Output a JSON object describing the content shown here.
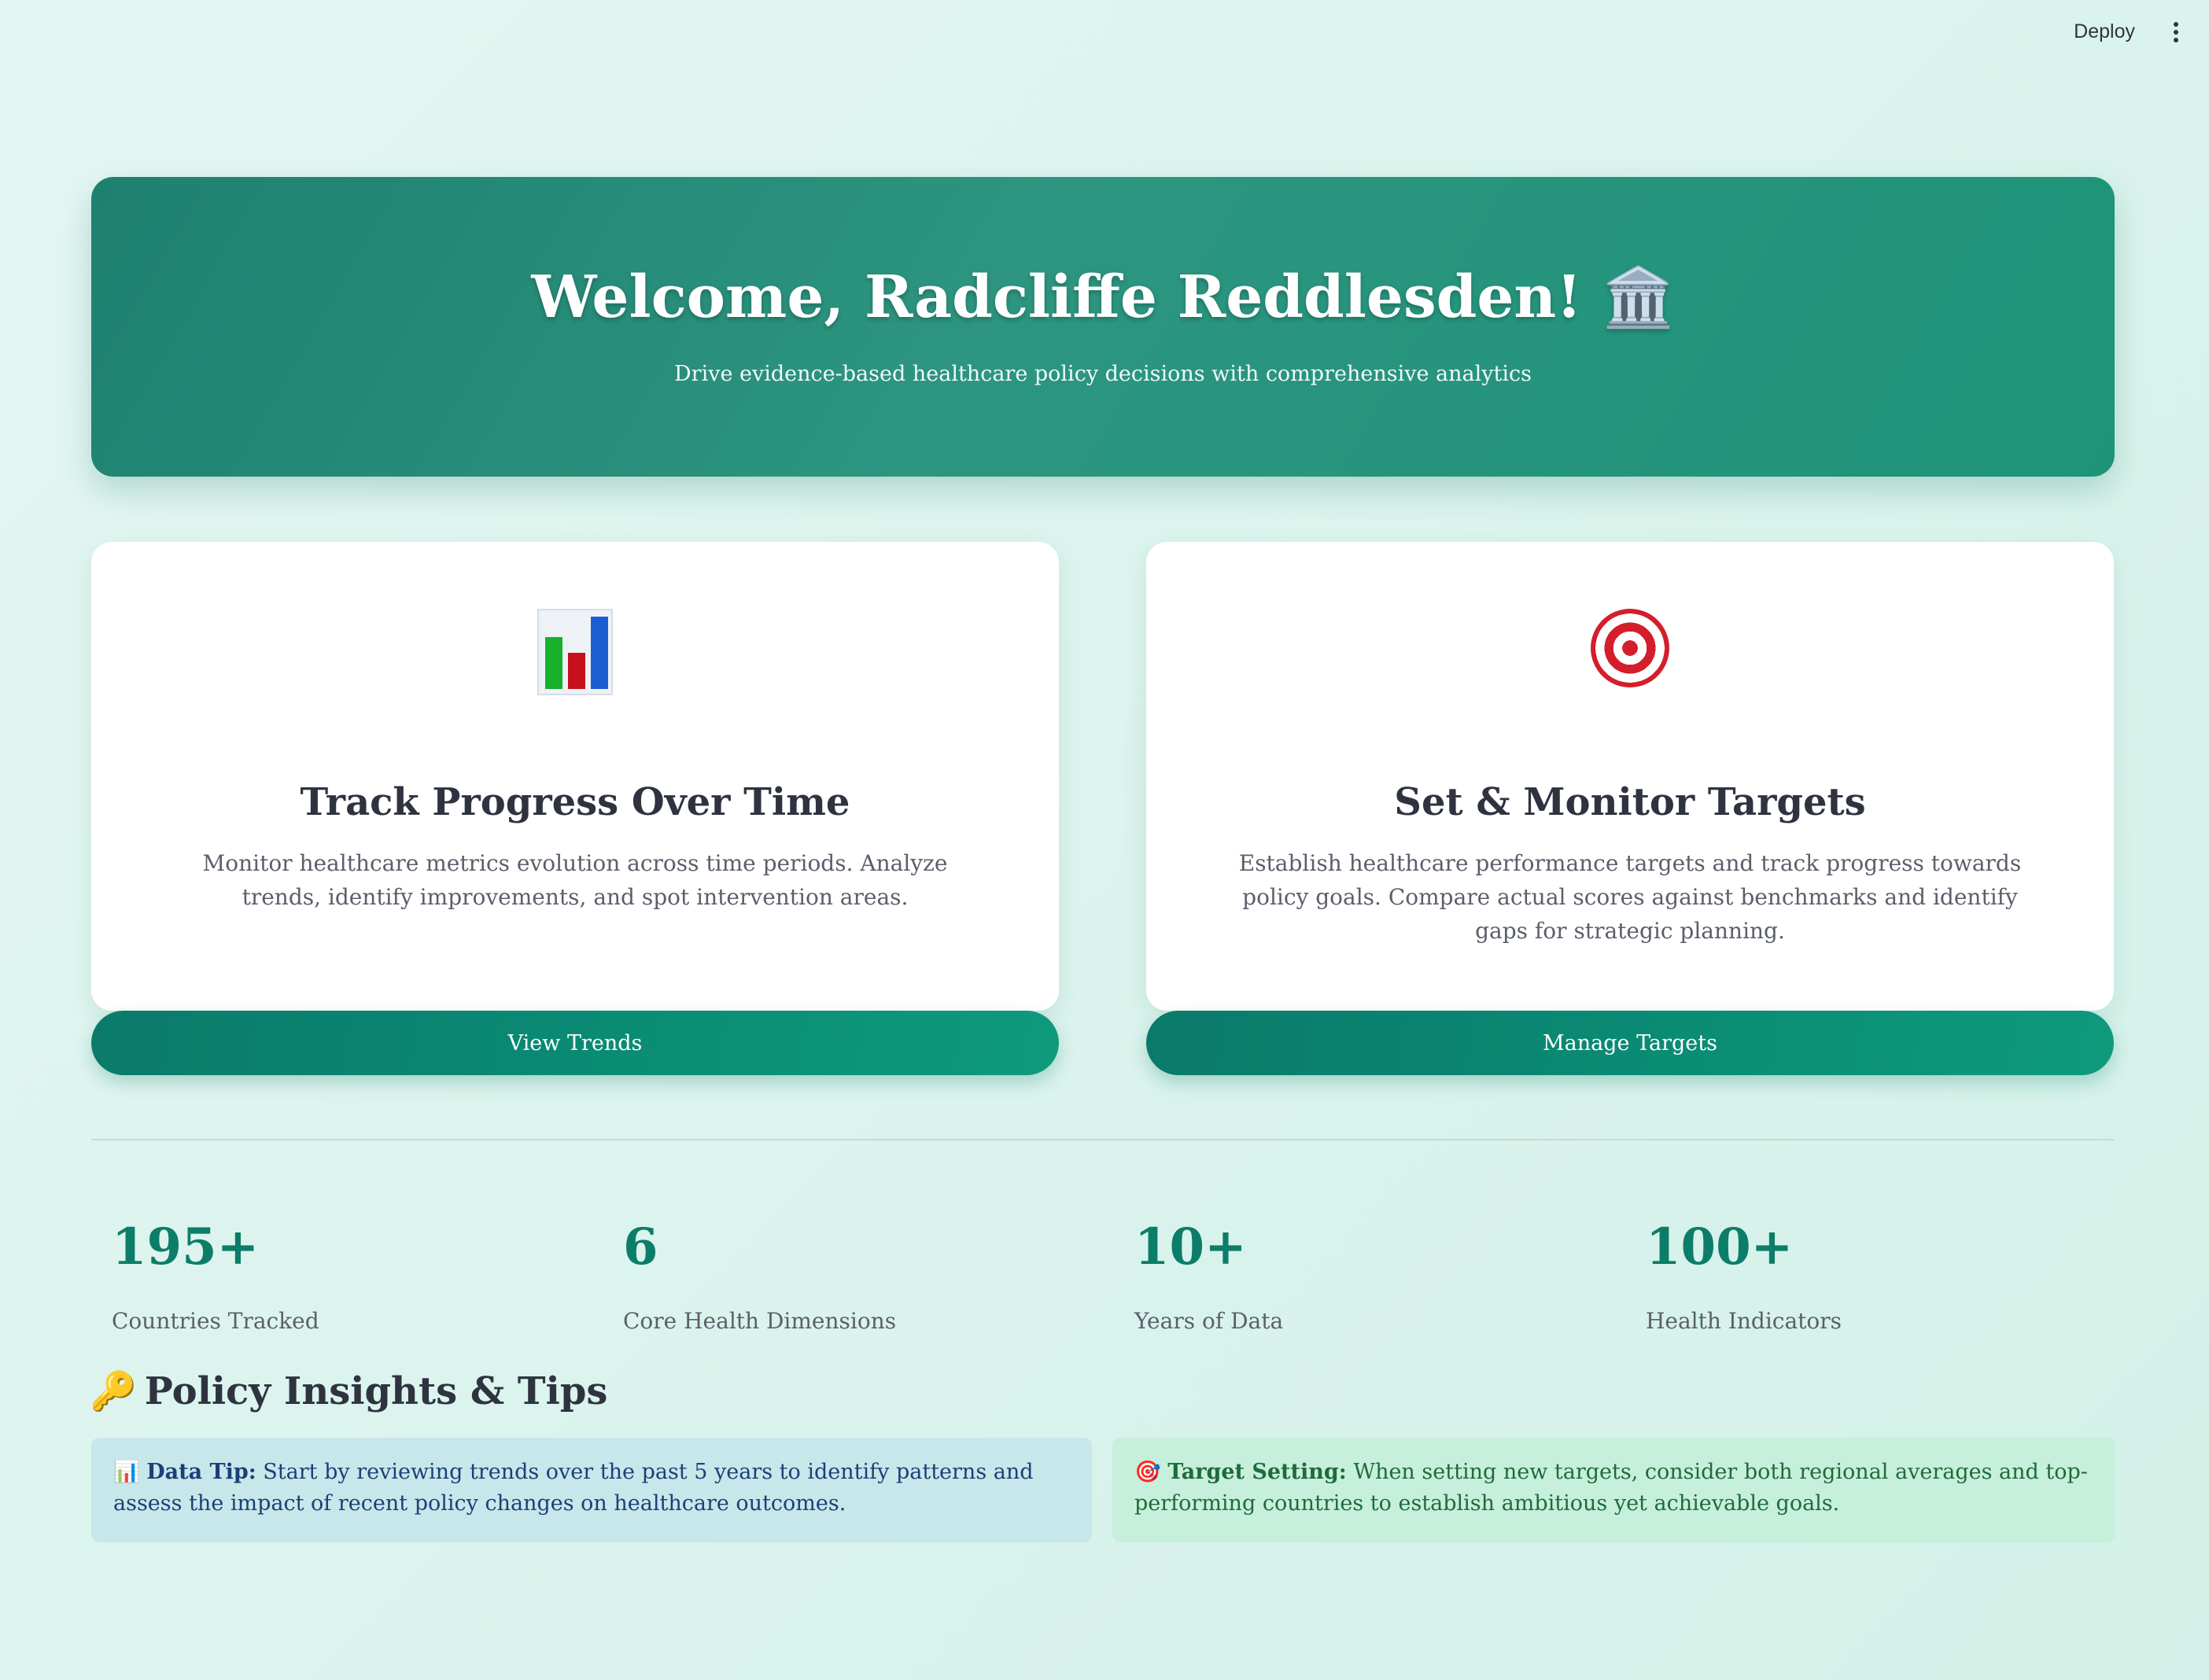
{
  "topbar": {
    "deploy_label": "Deploy"
  },
  "hero": {
    "title": "Welcome, Radcliffe Reddlesden! 🏛️",
    "subtitle": "Drive evidence-based healthcare policy decisions with comprehensive analytics"
  },
  "cards": [
    {
      "icon": "bar-chart-icon",
      "title": "Track Progress Over Time",
      "description": "Monitor healthcare metrics evolution across time periods. Analyze trends, identify improvements, and spot intervention areas.",
      "button_label": "View Trends"
    },
    {
      "icon": "target-icon",
      "title": "Set & Monitor Targets",
      "description": "Establish healthcare performance targets and track progress towards policy goals. Compare actual scores against benchmarks and identify gaps for strategic planning.",
      "button_label": "Manage Targets"
    }
  ],
  "stats": [
    {
      "value": "195+",
      "label": "Countries Tracked"
    },
    {
      "value": "6",
      "label": "Core Health Dimensions"
    },
    {
      "value": "10+",
      "label": "Years of Data"
    },
    {
      "value": "100+",
      "label": "Health Indicators"
    }
  ],
  "insights": {
    "title_icon": "🔑",
    "title": "Policy Insights & Tips",
    "tips": [
      {
        "icon": "📊",
        "heading": "Data Tip:",
        "text": " Start by reviewing trends over the past 5 years to identify patterns and assess the impact of recent policy changes on healthcare outcomes."
      },
      {
        "icon": "🎯",
        "heading": "Target Setting:",
        "text": " When setting new targets, consider both regional averages and top-performing countries to establish ambitious yet achievable goals."
      }
    ]
  },
  "colors": {
    "accent": "#0c7d68",
    "hero_bg": "#2a927d",
    "tip_blue_bg": "#c7e7ea",
    "tip_green_bg": "#c6efdc"
  }
}
